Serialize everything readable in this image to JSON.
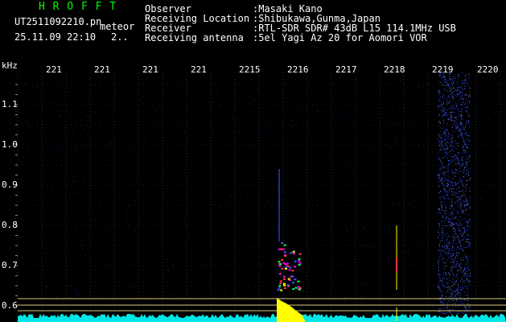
{
  "header": {
    "title": "H R O F F T",
    "filename": "UT2511092210.pn",
    "mode_label": "meteor",
    "datetime": "25.11.09 22:10",
    "page_marker": "2..",
    "fields": [
      {
        "label": "Observer",
        "value": ":Masaki Kano"
      },
      {
        "label": "Receiving Location",
        "value": ":Shibukawa,Gunma,Japan"
      },
      {
        "label": "Receiver",
        "value": ":RTL-SDR SDR# 43dB L15 114.1MHz USB"
      },
      {
        "label": "Receiving antenna",
        "value": ":5el Yagi Az 20 for Aomori VOR"
      }
    ]
  },
  "y_axis": {
    "unit": "kHz",
    "labels": [
      "1.1",
      "1.0",
      "0.9",
      "0.8",
      "0.7",
      "0.6"
    ]
  },
  "time_axis": {
    "labels": [
      "221",
      "221",
      "221",
      "221",
      "2215",
      "2216",
      "2217",
      "2218",
      "2219",
      "2220"
    ]
  },
  "colors": {
    "background": "#000000",
    "title": "#00ff00",
    "text": "#ffffff",
    "grid": "#2a2a2a",
    "guide_lines": "#ffff66",
    "noise_baseline": "#00ffff",
    "echo_hot": "#ff00ff",
    "echo_warm": "#ff3b3b",
    "echo_mid": "#00ff66",
    "echo_yellow": "#ffff00"
  }
}
